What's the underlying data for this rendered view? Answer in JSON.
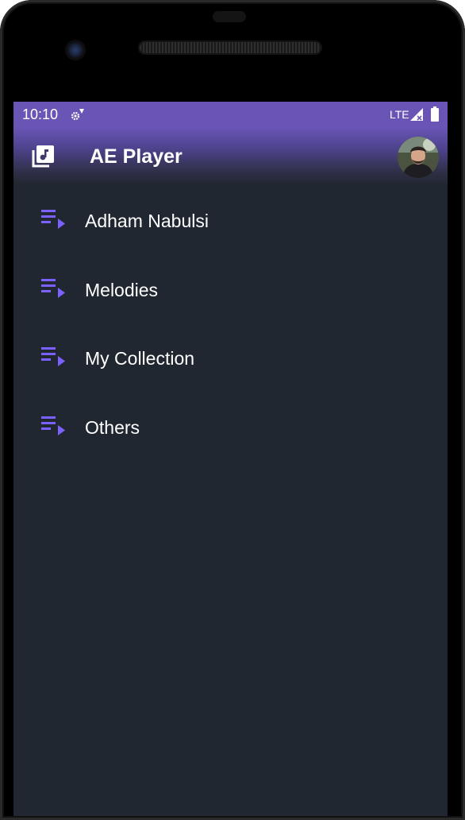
{
  "device": {
    "frame_color": "#000000"
  },
  "status_bar": {
    "time": "10:10",
    "network": "LTE",
    "background": "#6a55b6",
    "icons": [
      "gear-icon",
      "signal-icon",
      "battery-icon"
    ]
  },
  "app_bar": {
    "title": "AE Player",
    "logo_icon": "music-library-icon",
    "avatar": "user-avatar"
  },
  "theme": {
    "accent": "#7b61ff",
    "background": "#212731",
    "text": "#ffffff"
  },
  "playlists": [
    {
      "label": "Adham Nabulsi",
      "icon": "playlist-play-icon"
    },
    {
      "label": "Melodies",
      "icon": "playlist-play-icon"
    },
    {
      "label": "My Collection",
      "icon": "playlist-play-icon"
    },
    {
      "label": "Others",
      "icon": "playlist-play-icon"
    }
  ]
}
